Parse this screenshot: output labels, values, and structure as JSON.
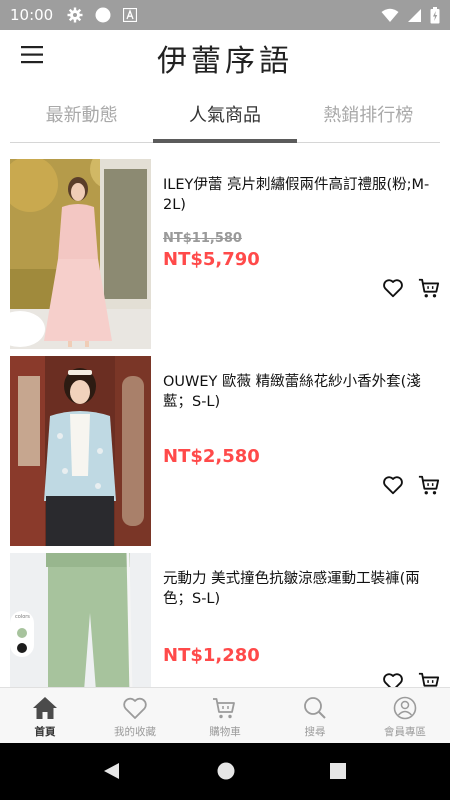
{
  "status_bar": {
    "time": "10:00"
  },
  "app": {
    "title": "伊蕾序語"
  },
  "tabs": [
    {
      "label": "最新動態",
      "active": false
    },
    {
      "label": "人氣商品",
      "active": true
    },
    {
      "label": "熱銷排行榜",
      "active": false
    }
  ],
  "products": [
    {
      "name": "ILEY伊蕾 亮片刺繡假兩件高訂禮服(粉;M-2L)",
      "original_price": "NT$11,580",
      "price": "NT$5,790"
    },
    {
      "name": "OUWEY 歐薇 精緻蕾絲花紗小香外套(淺藍；S-L)",
      "original_price": "",
      "price": "NT$2,580"
    },
    {
      "name": "元動力 美式撞色抗皺涼感運動工裝褲(兩色；S-L)",
      "original_price": "",
      "price": "NT$1,280",
      "swatch_label": "colors"
    }
  ],
  "bottom_nav": [
    {
      "label": "首頁",
      "icon": "home-icon",
      "active": true
    },
    {
      "label": "我的收藏",
      "icon": "heart-icon",
      "active": false
    },
    {
      "label": "購物車",
      "icon": "cart-icon",
      "active": false
    },
    {
      "label": "搜尋",
      "icon": "search-icon",
      "active": false
    },
    {
      "label": "會員專區",
      "icon": "user-icon",
      "active": false
    }
  ],
  "colors": {
    "sale_price": "#ff4a4a",
    "status_bar": "#9e9e9e",
    "tab_indicator": "#5b5b5b"
  }
}
